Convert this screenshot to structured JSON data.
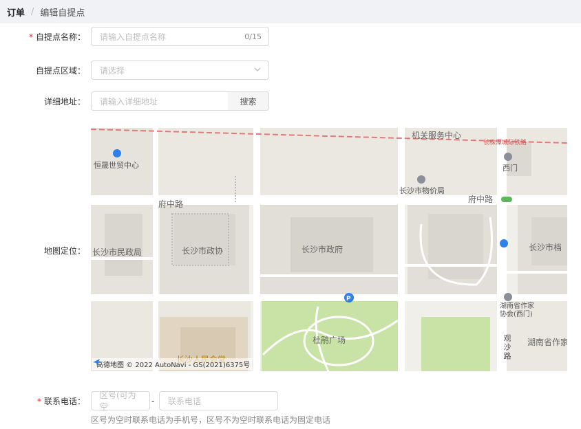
{
  "breadcrumb": {
    "root": "订单",
    "separator": "/",
    "current": "编辑自提点"
  },
  "form": {
    "name": {
      "label": "自提点名称：",
      "required": "*",
      "placeholder": "请输入自提点名称",
      "counter": "0/15"
    },
    "region": {
      "label": "自提点区域：",
      "placeholder": "请选择"
    },
    "address": {
      "label": "详细地址：",
      "placeholder": "请输入详细地址",
      "search_button": "搜索"
    },
    "map": {
      "label": "地图定位："
    },
    "phone": {
      "label": "联系电话：",
      "required": "*",
      "area_placeholder": "区号(可为空",
      "dash": "-",
      "phone_placeholder": "联系电话",
      "hint": "区号为空时联系电话为手机号，区号不为空时联系电话为固定电话"
    }
  },
  "map": {
    "labels": {
      "hengsheng": "恒晟世贸中心",
      "jiguan": "机关服务中心",
      "railway": "长株潭城际铁路",
      "ximen": "西门",
      "wujia": "长沙市物价局",
      "fuzhong_left": "府中路",
      "fuzhong_right": "府中路",
      "minzheng": "长沙市民政局",
      "zhengxie": "长沙市政协",
      "zhengfu": "长沙市政府",
      "dangan": "长沙市档",
      "zuojia": "湖南省作家协会(西门)",
      "zuojia_line1": "湖南省作家",
      "zuojia_line2": "协会(西门)",
      "dupeng": "杜鹃广场",
      "renmin": "长沙人民会堂",
      "guansha": "观沙路",
      "hunan_zuo": "湖南省作家"
    },
    "attribution": "高德地图 © 2022 AutoNavi - GS(2021)6375号"
  },
  "colors": {
    "required": "#f5222d",
    "park": "#c9e3a6",
    "building": "#dedbd5",
    "road": "#ffffff",
    "rail": "#e07a7a",
    "poi_blue": "#2f80ed"
  }
}
